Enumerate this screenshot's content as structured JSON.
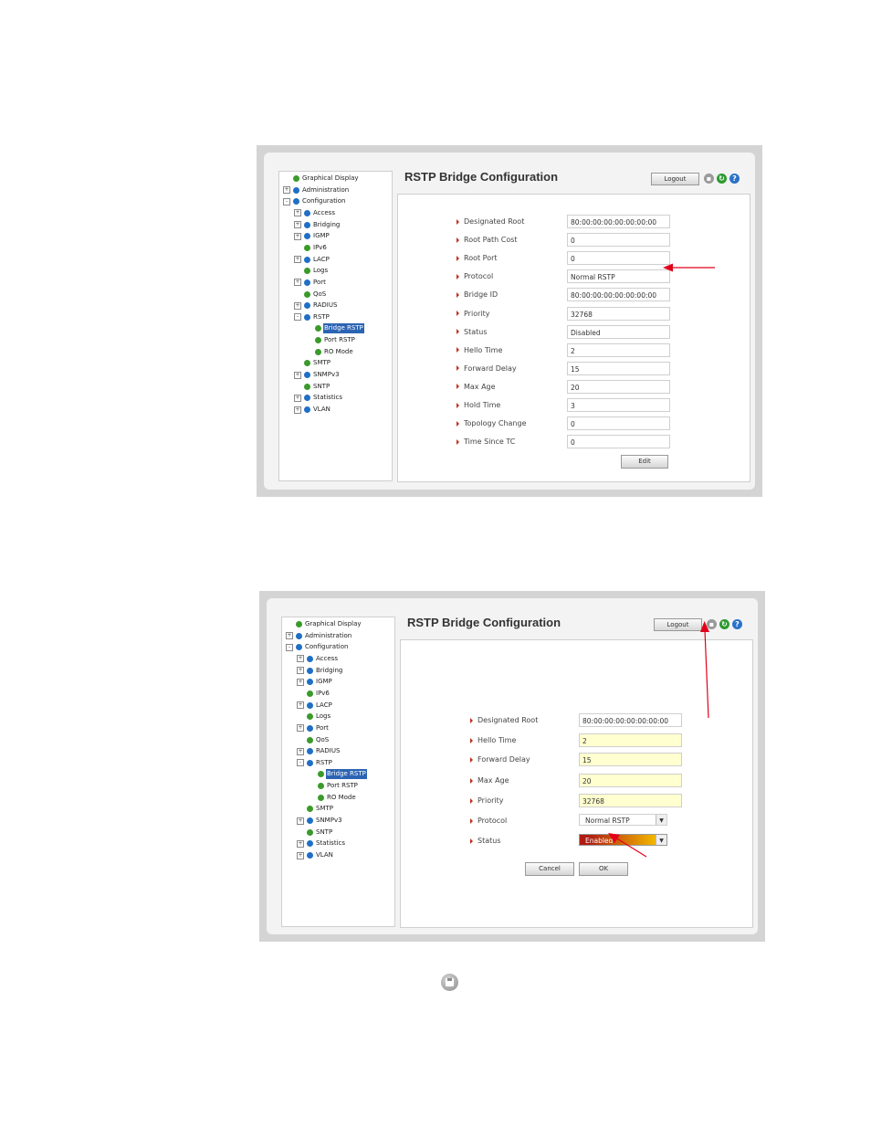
{
  "screen1": {
    "title": "RSTP Bridge Configuration",
    "logout_label": "Logout",
    "tree": [
      {
        "label": "Graphical Display",
        "level": 0,
        "expander": "",
        "leaf": true
      },
      {
        "label": "Administration",
        "level": 0,
        "expander": "+",
        "leaf": false
      },
      {
        "label": "Configuration",
        "level": 0,
        "expander": "-",
        "leaf": false
      },
      {
        "label": "Access",
        "level": 1,
        "expander": "+",
        "leaf": false
      },
      {
        "label": "Bridging",
        "level": 1,
        "expander": "+",
        "leaf": false
      },
      {
        "label": "IGMP",
        "level": 1,
        "expander": "+",
        "leaf": false
      },
      {
        "label": "IPv6",
        "level": 1,
        "expander": "",
        "leaf": true
      },
      {
        "label": "LACP",
        "level": 1,
        "expander": "+",
        "leaf": false
      },
      {
        "label": "Logs",
        "level": 1,
        "expander": "",
        "leaf": true
      },
      {
        "label": "Port",
        "level": 1,
        "expander": "+",
        "leaf": false
      },
      {
        "label": "QoS",
        "level": 1,
        "expander": "",
        "leaf": true
      },
      {
        "label": "RADIUS",
        "level": 1,
        "expander": "+",
        "leaf": false
      },
      {
        "label": "RSTP",
        "level": 1,
        "expander": "-",
        "leaf": false
      },
      {
        "label": "Bridge RSTP",
        "level": 2,
        "expander": "",
        "leaf": true,
        "selected": true
      },
      {
        "label": "Port RSTP",
        "level": 2,
        "expander": "",
        "leaf": true
      },
      {
        "label": "RO Mode",
        "level": 2,
        "expander": "",
        "leaf": true
      },
      {
        "label": "SMTP",
        "level": 1,
        "expander": "",
        "leaf": true
      },
      {
        "label": "SNMPv3",
        "level": 1,
        "expander": "+",
        "leaf": false
      },
      {
        "label": "SNTP",
        "level": 1,
        "expander": "",
        "leaf": true
      },
      {
        "label": "Statistics",
        "level": 1,
        "expander": "+",
        "leaf": false
      },
      {
        "label": "VLAN",
        "level": 1,
        "expander": "+",
        "leaf": false
      }
    ],
    "fields": [
      {
        "label": "Designated Root",
        "value": "80:00:00:00:00:00:00:00"
      },
      {
        "label": "Root Path Cost",
        "value": "0"
      },
      {
        "label": "Root Port",
        "value": "0"
      },
      {
        "label": "Protocol",
        "value": "Normal RSTP"
      },
      {
        "label": "Bridge ID",
        "value": "80:00:00:00:00:00:00:00"
      },
      {
        "label": "Priority",
        "value": "32768"
      },
      {
        "label": "Status",
        "value": "Disabled"
      },
      {
        "label": "Hello Time",
        "value": "2"
      },
      {
        "label": "Forward Delay",
        "value": "15"
      },
      {
        "label": "Max Age",
        "value": "20"
      },
      {
        "label": "Hold Time",
        "value": "3"
      },
      {
        "label": "Topology Change",
        "value": "0"
      },
      {
        "label": "Time Since TC",
        "value": "0"
      }
    ],
    "edit_label": "Edit"
  },
  "screen2": {
    "title": "RSTP Bridge Configuration",
    "logout_label": "Logout",
    "fields": [
      {
        "label": "Designated Root",
        "value": "80:00:00:00:00:00:00:00",
        "style": "plain"
      },
      {
        "label": "Hello Time",
        "value": "2",
        "style": "yellow"
      },
      {
        "label": "Forward Delay",
        "value": "15",
        "style": "yellow"
      },
      {
        "label": "Max Age",
        "value": "20",
        "style": "yellow"
      },
      {
        "label": "Priority",
        "value": "32768",
        "style": "yellow"
      },
      {
        "label": "Protocol",
        "value": "Normal RSTP",
        "style": "select"
      },
      {
        "label": "Status",
        "value": "Enabled",
        "style": "select-enabled"
      }
    ],
    "cancel_label": "Cancel",
    "ok_label": "OK"
  },
  "colors": {
    "accent_red": "#e2001a",
    "tree_selected": "#2c64b4",
    "enabled_gradient_start": "#b01c10",
    "enabled_gradient_end": "#f0b400"
  },
  "icons": [
    "save-icon",
    "refresh-icon",
    "help-icon",
    "node-icon",
    "expander-icon",
    "dropdown-arrow-icon"
  ]
}
